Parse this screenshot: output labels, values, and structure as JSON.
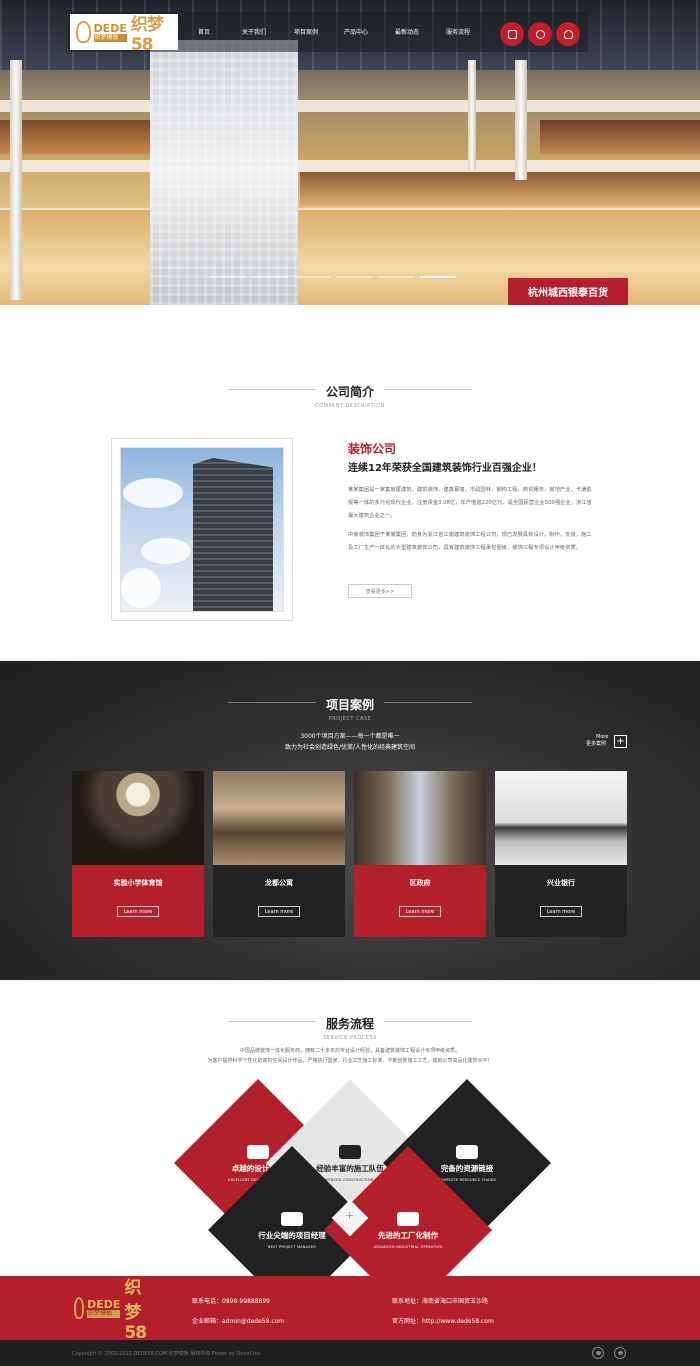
{
  "brand": {
    "logo_top": "DEDE",
    "logo_sub": "织梦模板",
    "logo_name": "织梦58"
  },
  "nav": {
    "items": [
      "首页",
      "关于我们",
      "项目案例",
      "产品中心",
      "最新动态",
      "服务流程"
    ],
    "icons": [
      "phone-icon",
      "wechat-icon",
      "qq-icon"
    ]
  },
  "hero": {
    "caption": "杭州城西银泰百货",
    "slides": 5,
    "active_slide": 5
  },
  "intro": {
    "title": "公司简介",
    "subtitle": "COMPANY DESCRIPTION",
    "heading": "装饰公司",
    "tagline": "连续12年荣获全国建筑装饰行业百强企业！",
    "para1": "某某集团是一家集房屋建筑，建筑装饰，建筑幕墙，市政园林，钢构工程，商贸服务，房地产业，卡通影视等一体的多元化现代企业。注册资金3.08亿，年产值逾220亿元，是全国民营企业500强企业，浙江省最大建筑企业之一。",
    "para2": "中南装饰集团于某某集团，前身为浙江省江南建筑装饰工程公司，现已发展具有设计，制作，安装，施工及工厂生产一体化的大型建筑装饰公司，具有建筑装饰工程承包壹级，装饰工程专项设计甲级资质。",
    "more": "查看更多>>"
  },
  "cases": {
    "title": "项目案例",
    "subtitle": "PROJECT CASE",
    "line1": "3000个项目方案——每一个都是唯一",
    "line2": "致力为社会创造绿色/优美/人性化的经典建筑空间",
    "more_en": "More",
    "more_cn": "更多案例",
    "items": [
      {
        "name": "实验小学体育馆",
        "button": "Learn more"
      },
      {
        "name": "龙都公寓",
        "button": "Learn more"
      },
      {
        "name": "区政府",
        "button": "Learn more"
      },
      {
        "name": "兴业银行",
        "button": "Learn more"
      }
    ]
  },
  "process": {
    "title": "服务流程",
    "subtitle": "SERVICE PROCESS",
    "line1": "中国品牌装饰一体化服务商，拥有二十多年的专业设计经验，具备建筑装饰工程设计专项甲级资质。",
    "line2": "为客户提供科学个性化的高的空间设计作品，严格执行国家、行业工艺施工标准，不断创新施工工艺，成就公司高品化装饰水平！",
    "steps": [
      {
        "title": "卓越的设计实力",
        "en": "EXCELLENT DESIGN STRENGTH",
        "icon": "design-icon"
      },
      {
        "title": "经验丰富的施工队伍",
        "en": "EXPERIENCED CONSTRUCTION TEAM",
        "icon": "construction-icon"
      },
      {
        "title": "完备的资源链接",
        "en": "COMPLETE RESOURCE CHAINS",
        "icon": "resource-icon"
      },
      {
        "title": "行业尖端的项目经理",
        "en": "BEST PROJECT MANAGER",
        "icon": "team-icon"
      },
      {
        "title": "先进的工厂化制作",
        "en": "ADVANCED INDUSTRIAL OPERATION",
        "icon": "factory-icon"
      }
    ]
  },
  "footer": {
    "phone": "联系电话：0898-99888899",
    "email": "企业邮箱：admin@dede58.com",
    "address": "联系地址：海南省海口市国贸玉沙路",
    "website": "官方网址：http://www.dede58.com",
    "copyright": "Copyright © 2002-2011 DEDE58.COM 织梦模板 版权所有 Power by DedeCms",
    "social": [
      "weibo-icon",
      "wechat-icon"
    ]
  },
  "colors": {
    "accent": "#b3202c",
    "dark": "#212121",
    "gold": "#d2a14b"
  }
}
